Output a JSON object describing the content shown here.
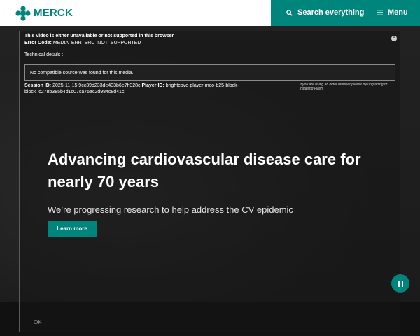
{
  "header": {
    "brand": "MERCK",
    "search_label": "Search everything",
    "menu_label": "Menu"
  },
  "player": {
    "error_title": "This video is either unavailable or not supported in this browser",
    "error_code_label": "Error Code:",
    "error_code_value": "MEDIA_ERR_SRC_NOT_SUPPORTED",
    "technical_label": "Technical details :",
    "technical_message": "No compatible source was found for this media.",
    "session_label": "Session ID:",
    "session_value": "2025-11-15:9cc39d233de433b6e7ff328c",
    "player_label": "Player ID:",
    "player_value": "brightcove-player-mco-b25-block-block_c278b385b4d1c07ca76ac2d984c8d41c",
    "flash_note": "If you are using an older browser please try upgrading or installing Flash.",
    "close_glyph": "×",
    "ok_label": "OK"
  },
  "hero": {
    "title": "Advancing cardiovascular disease care for nearly 70 years",
    "subtitle": "We’re progressing research to help address the CV epidemic",
    "cta_label": "Learn more"
  },
  "colors": {
    "brand_teal": "#00857c",
    "background": "#1c1c1c"
  },
  "icons": {
    "logo": "merck-logo-icon",
    "search": "search-icon",
    "menu": "hamburger-icon",
    "close": "close-icon",
    "pause": "pause-icon"
  }
}
